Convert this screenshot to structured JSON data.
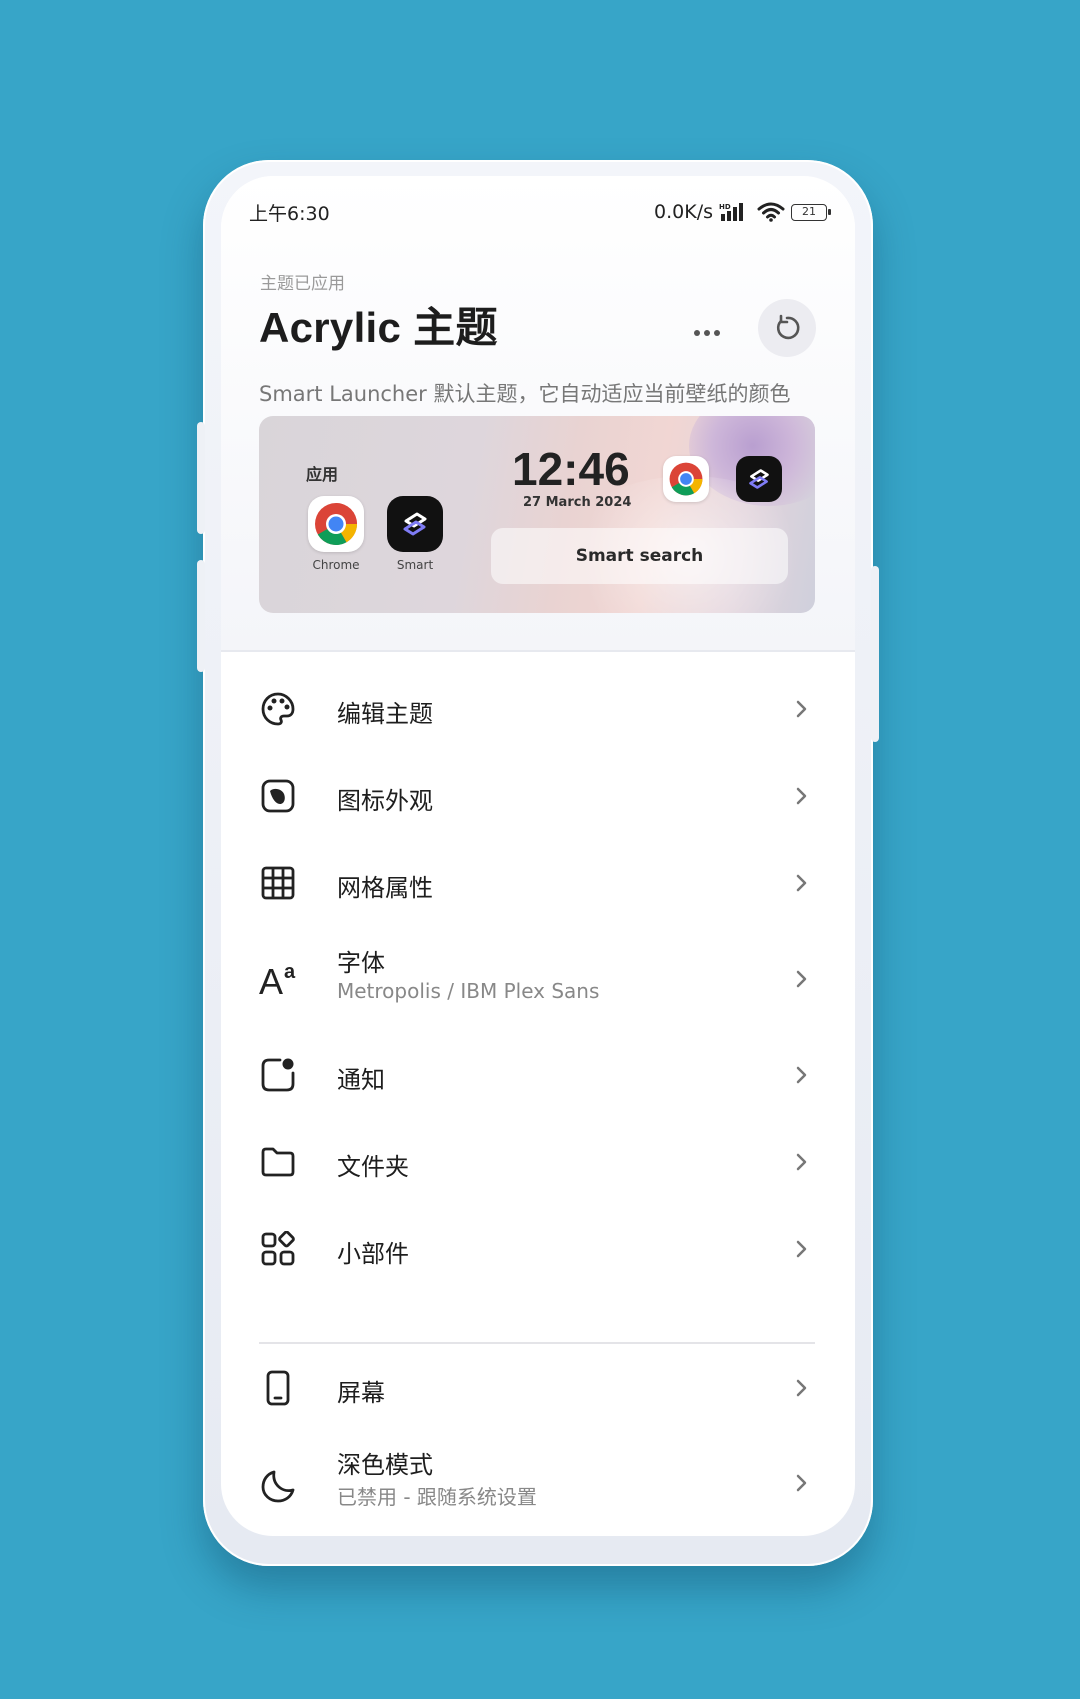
{
  "status_bar": {
    "time": "上午6:30",
    "network_speed": "0.0K/s",
    "hd_badge": "HD",
    "battery": "21"
  },
  "theme": {
    "applied_label": "主题已应用",
    "title": "Acrylic 主题",
    "description": "Smart Launcher 默认主题，它自动适应当前壁纸的颜色"
  },
  "preview": {
    "apps_label": "应用",
    "app1_label": "Chrome",
    "app2_label": "Smart",
    "clock": "12:46",
    "date": "27 March 2024",
    "search_label": "Smart search"
  },
  "menu": {
    "edit_theme": "编辑主题",
    "icon_appearance": "图标外观",
    "grid_properties": "网格属性",
    "font": "字体",
    "font_value": "Metropolis / IBM Plex Sans",
    "notifications": "通知",
    "folders": "文件夹",
    "widgets": "小部件",
    "screen": "屏幕",
    "dark_mode": "深色模式",
    "dark_mode_value": "已禁用 - 跟随系统设置"
  },
  "colors": {
    "background": "#37a5c8",
    "accent_text": "#1e1e1e",
    "secondary_text": "#888888"
  }
}
